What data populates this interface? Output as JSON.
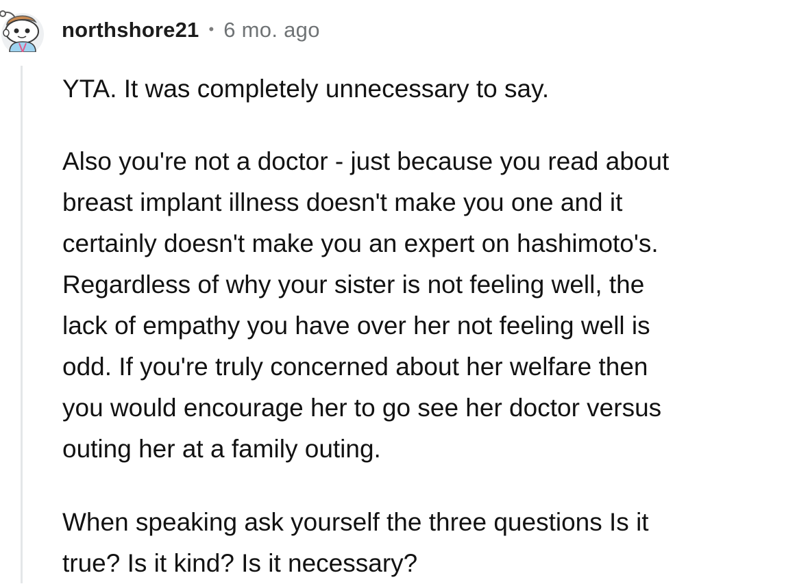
{
  "comment": {
    "author": "northshore21",
    "separator": "•",
    "timestamp": "6 mo. ago",
    "avatar_icon": "reddit-snoo-avatar-icon",
    "paragraphs": [
      [
        "YTA. It was completely unnecessary to say."
      ],
      [
        "Also you're not a doctor - just because you read about",
        "breast implant illness doesn't make you one and it",
        "certainly doesn't make you an expert on hashimoto's.",
        "Regardless of why your sister is not feeling well, the",
        "lack of empathy you have over her not feeling well is",
        "odd. If you're truly concerned about her welfare then",
        "you would encourage her to go see her doctor versus",
        "outing her at a family outing."
      ],
      [
        "When speaking ask yourself the three questions Is it",
        "true? Is it kind? Is it necessary?"
      ]
    ]
  },
  "colors": {
    "username": "#1c1c1c",
    "timestamp": "#6f7375",
    "thread_line": "#e4e6e8",
    "body_text": "#121212"
  }
}
